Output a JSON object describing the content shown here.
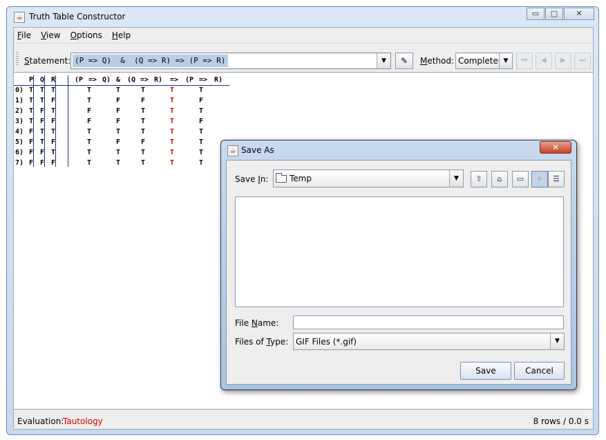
{
  "window": {
    "title": "Truth Table Constructor",
    "minimize": "▭",
    "maximize": "□",
    "close": "✕"
  },
  "menu": {
    "file_u": "F",
    "file_rest": "ile",
    "view_u": "V",
    "view_rest": "iew",
    "options_u": "O",
    "options_rest": "ptions",
    "help_u": "H",
    "help_rest": "elp"
  },
  "toolbar": {
    "statement_u": "S",
    "statement_rest": "tatement:",
    "statement_value": "(P => Q)  &  (Q => R) => (P => R)",
    "method_u": "M",
    "method_rest": "ethod:",
    "method_value": "Complete"
  },
  "truth_table": {
    "header": [
      "P",
      "Q",
      "R",
      "(P",
      "=>",
      "Q)",
      "&",
      "(Q",
      "=>",
      "R)",
      "=>",
      "(P",
      "=>",
      "R)"
    ],
    "rows": [
      {
        "idx": "0)",
        "p": "T",
        "q": "T",
        "r": "T",
        "c1": "T",
        "c2": "T",
        "c3": "T",
        "c4": "T",
        "c5": "T"
      },
      {
        "idx": "1)",
        "p": "T",
        "q": "T",
        "r": "F",
        "c1": "T",
        "c2": "F",
        "c3": "F",
        "c4": "T",
        "c5": "F"
      },
      {
        "idx": "2)",
        "p": "T",
        "q": "F",
        "r": "T",
        "c1": "F",
        "c2": "F",
        "c3": "T",
        "c4": "T",
        "c5": "T"
      },
      {
        "idx": "3)",
        "p": "T",
        "q": "F",
        "r": "F",
        "c1": "F",
        "c2": "F",
        "c3": "T",
        "c4": "T",
        "c5": "F"
      },
      {
        "idx": "4)",
        "p": "F",
        "q": "T",
        "r": "T",
        "c1": "T",
        "c2": "T",
        "c3": "T",
        "c4": "T",
        "c5": "T"
      },
      {
        "idx": "5)",
        "p": "F",
        "q": "T",
        "r": "F",
        "c1": "T",
        "c2": "F",
        "c3": "F",
        "c4": "T",
        "c5": "T"
      },
      {
        "idx": "6)",
        "p": "F",
        "q": "F",
        "r": "T",
        "c1": "T",
        "c2": "T",
        "c3": "T",
        "c4": "T",
        "c5": "T"
      },
      {
        "idx": "7)",
        "p": "F",
        "q": "F",
        "r": "F",
        "c1": "T",
        "c2": "T",
        "c3": "T",
        "c4": "T",
        "c5": "T"
      }
    ]
  },
  "status": {
    "evaluation_label": "Evaluation:",
    "evaluation_value": "Tautology",
    "rows_info": "8 rows / 0.0 s"
  },
  "dialog": {
    "title": "Save As",
    "close": "✕",
    "save_in_pre": "Save ",
    "save_in_u": "I",
    "save_in_post": "n:",
    "save_in_value": "Temp",
    "file_name_pre": "File ",
    "file_name_u": "N",
    "file_name_post": "ame:",
    "file_name_value": "",
    "files_type_pre": "Files of ",
    "files_type_u": "T",
    "files_type_post": "ype:",
    "files_type_value": "GIF Files (*.gif)",
    "save_button": "Save",
    "cancel_button": "Cancel"
  },
  "colors": {
    "accent_red": "#d40000",
    "selection": "#b8cfe5"
  }
}
